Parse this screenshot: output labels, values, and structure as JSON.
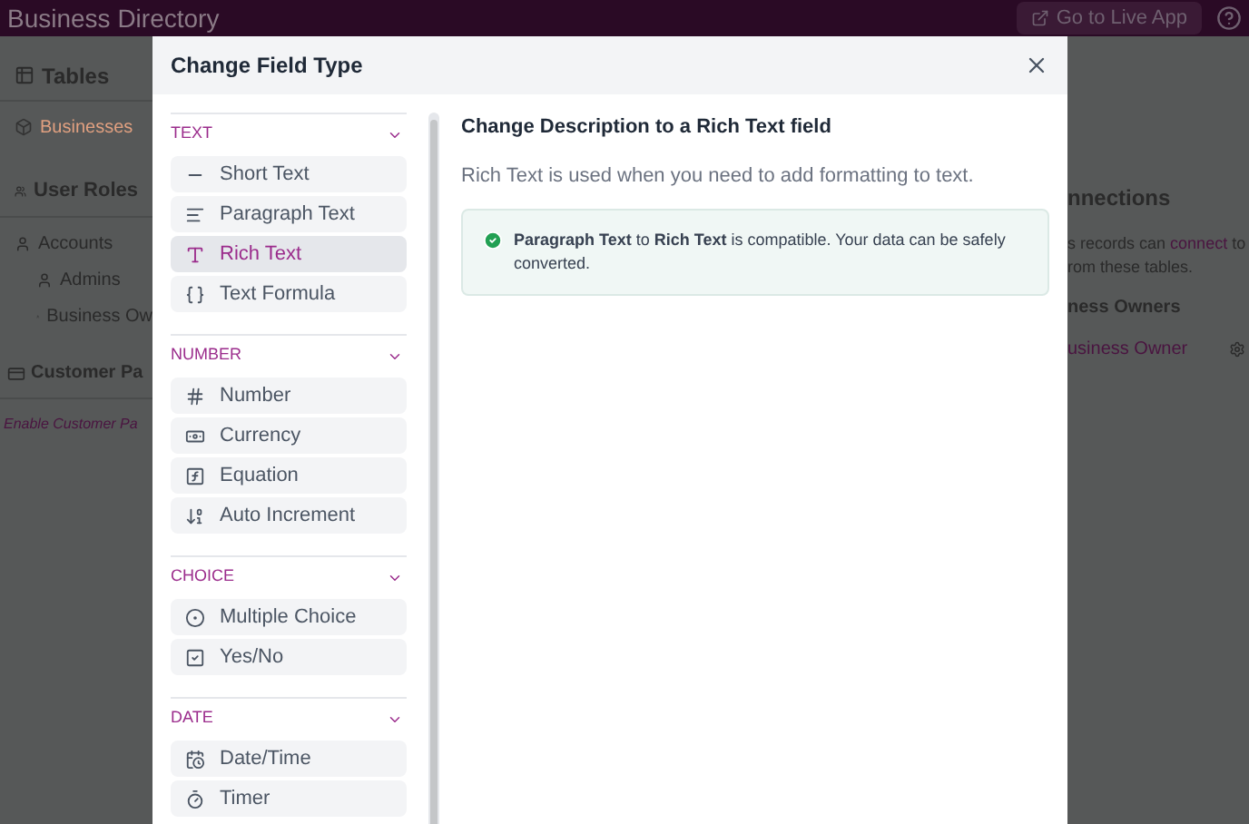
{
  "app_bar": {
    "title": "Business Directory",
    "live_button": "Go to Live App"
  },
  "sidebar": {
    "tables_heading": "Tables",
    "tables": [
      {
        "label": "Businesses",
        "selected": true
      }
    ],
    "roles_heading": "User Roles",
    "roles": [
      {
        "label": "Accounts",
        "children": [
          {
            "label": "Admins"
          },
          {
            "label": "Business Ow"
          }
        ]
      }
    ],
    "payments_heading": "Customer Pa",
    "payments_link": "Enable Customer Pa"
  },
  "connections": {
    "title": "nnections",
    "text_before": "s records can",
    "link": "connect",
    "text_after": "to",
    "line_2": "rom these tables.",
    "group": "ness Owners",
    "item": "usiness Owner"
  },
  "dialog": {
    "title": "Change Field Type",
    "sections": [
      {
        "title": "TEXT",
        "items": [
          {
            "kind": "short",
            "label": "Short Text",
            "selected": false
          },
          {
            "kind": "paragraph",
            "label": "Paragraph Text",
            "selected": false
          },
          {
            "kind": "rich",
            "label": "Rich Text",
            "selected": true
          },
          {
            "kind": "formula",
            "label": "Text Formula",
            "selected": false
          }
        ]
      },
      {
        "title": "NUMBER",
        "items": [
          {
            "kind": "number",
            "label": "Number",
            "selected": false
          },
          {
            "kind": "currency",
            "label": "Currency",
            "selected": false
          },
          {
            "kind": "equation",
            "label": "Equation",
            "selected": false
          },
          {
            "kind": "increment",
            "label": "Auto Increment",
            "selected": false
          }
        ]
      },
      {
        "title": "CHOICE",
        "items": [
          {
            "kind": "multiple",
            "label": "Multiple Choice",
            "selected": false
          },
          {
            "kind": "boolean",
            "label": "Yes/No",
            "selected": false
          }
        ]
      },
      {
        "title": "DATE",
        "items": [
          {
            "kind": "datetime",
            "label": "Date/Time",
            "selected": false
          },
          {
            "kind": "timer",
            "label": "Timer",
            "selected": false
          }
        ]
      }
    ],
    "heading": "Change Description to a Rich Text field",
    "description": "Rich Text is used when you need to add formatting to text.",
    "notice": "**Paragraph Text** to **Rich Text** is compatible. Your data can be safely converted."
  }
}
